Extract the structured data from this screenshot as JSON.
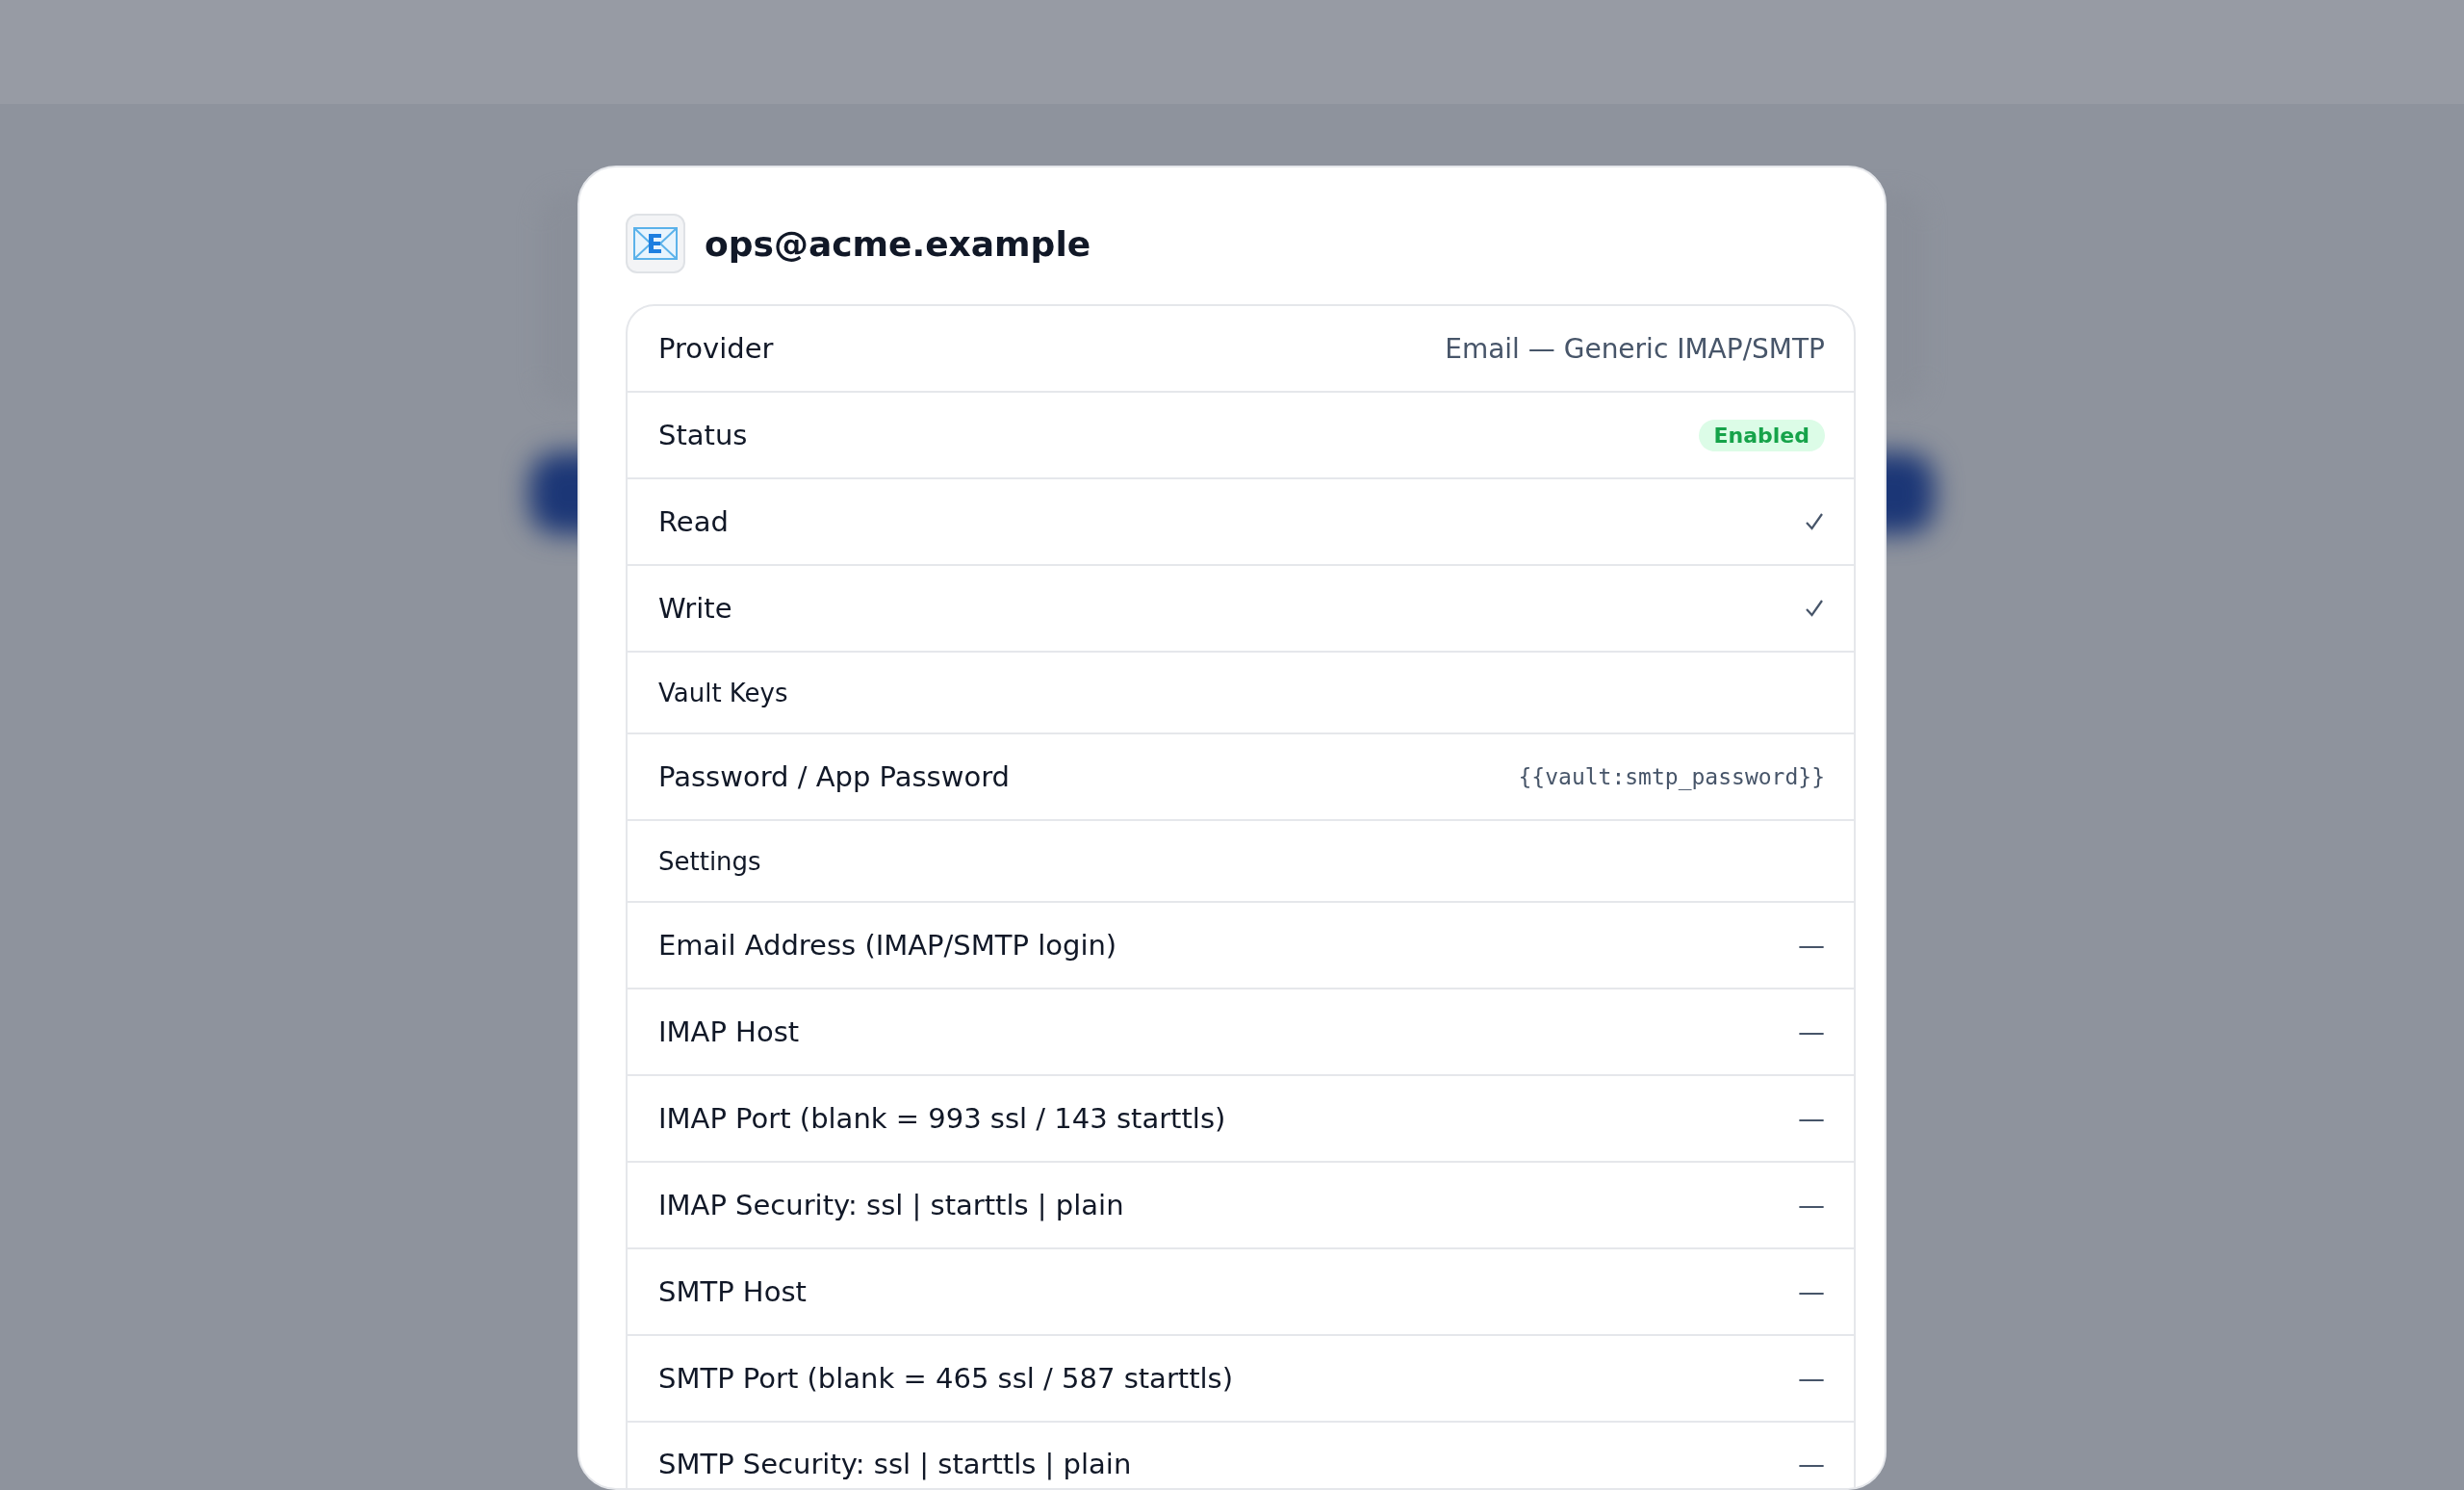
{
  "dialog": {
    "title": "ops@acme.example",
    "rows": [
      {
        "kind": "value",
        "label": "Provider",
        "value": "Email — Generic IMAP/SMTP"
      },
      {
        "kind": "badge",
        "label": "Status",
        "value": "Enabled"
      },
      {
        "kind": "check",
        "label": "Read",
        "checked": true
      },
      {
        "kind": "check",
        "label": "Write",
        "checked": true
      },
      {
        "kind": "section",
        "label": "Vault Keys"
      },
      {
        "kind": "mono",
        "label": "Password / App Password",
        "value": "{{vault:smtp_password}}"
      },
      {
        "kind": "section",
        "label": "Settings"
      },
      {
        "kind": "value",
        "label": "Email Address (IMAP/SMTP login)",
        "value": "—"
      },
      {
        "kind": "value",
        "label": "IMAP Host",
        "value": "—"
      },
      {
        "kind": "value",
        "label": "IMAP Port (blank = 993 ssl / 143 starttls)",
        "value": "—"
      },
      {
        "kind": "value",
        "label": "IMAP Security: ssl | starttls | plain",
        "value": "—"
      },
      {
        "kind": "value",
        "label": "SMTP Host",
        "value": "—"
      },
      {
        "kind": "value",
        "label": "SMTP Port (blank = 465 ssl / 587 starttls)",
        "value": "—"
      },
      {
        "kind": "value",
        "label": "SMTP Security: ssl | starttls | plain",
        "value": "—"
      }
    ]
  }
}
